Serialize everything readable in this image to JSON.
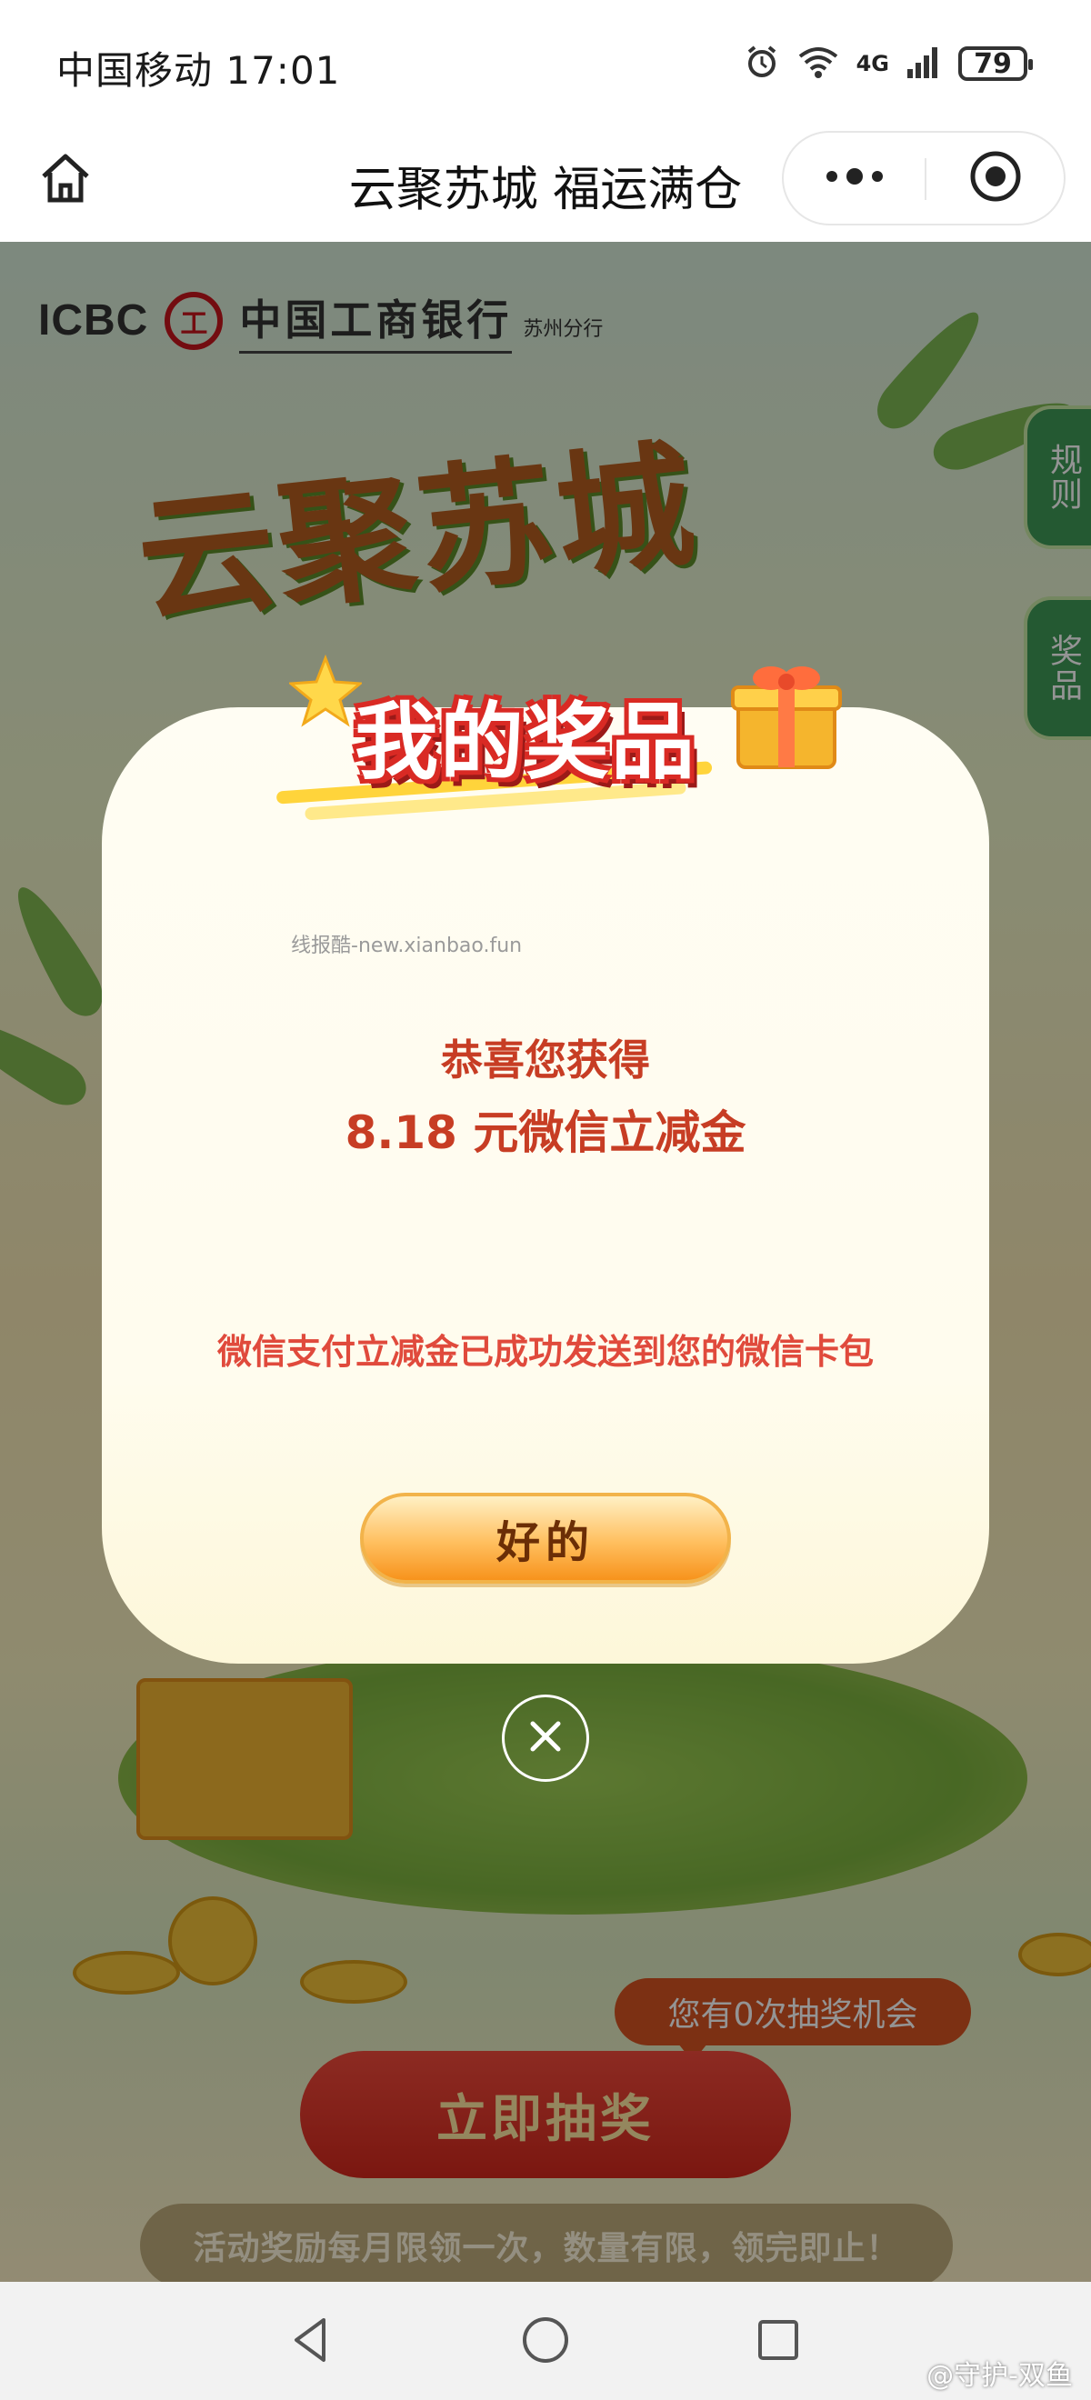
{
  "status_bar": {
    "carrier_time": "中国移动 17:01",
    "network": "4G",
    "battery": "79"
  },
  "nav": {
    "title": "云聚苏城 福运满仓"
  },
  "page": {
    "bank_en": "ICBC",
    "bank_seal": "工",
    "bank_cn": "中国工商银行",
    "branch": "苏州分行",
    "hero_title": "云聚苏城",
    "side_tabs": [
      "规则",
      "奖品"
    ],
    "chance_text": "您有0次抽奖机会",
    "draw_button": "立即抽奖",
    "notice": "活动奖励每月限领一次，数量有限，领完即止！"
  },
  "modal": {
    "header_title": "我的奖品",
    "watermark": "线报酷-new.xianbao.fun",
    "congrats": "恭喜您获得",
    "prize": "8.18 元微信立减金",
    "sent_message": "微信支付立减金已成功发送到您的微信卡包",
    "ok_button": "好的"
  },
  "footer": {
    "weibo_mark": "@守护-双鱼"
  },
  "colors": {
    "accent_red": "#c73d24",
    "ok_button": "#f7931c",
    "draw_button": "#d4281d",
    "tab_green": "#3f9a57"
  },
  "icons": [
    "home-icon",
    "more-dots-icon",
    "target-close-icon",
    "alarm-icon",
    "wifi-icon",
    "signal-icon",
    "battery-icon",
    "close-icon",
    "back-triangle-icon",
    "home-circle-icon",
    "recents-square-icon"
  ]
}
